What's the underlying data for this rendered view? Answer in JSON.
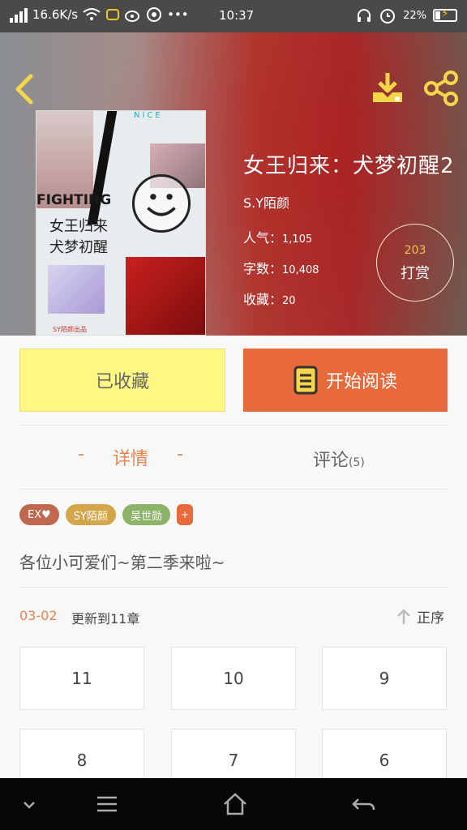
{
  "status_bar": {
    "speed": "16.6K/s",
    "time": "10:37",
    "battery": "22%"
  },
  "cover": {
    "top_label": "NICE",
    "fighting": "FIGHTING",
    "title_line1": "女王归来",
    "title_line2": "犬梦初醒",
    "author_line": "SY陌颜出品"
  },
  "book": {
    "title": "女王归来：犬梦初醒2",
    "author": "S.Y陌颜",
    "popularity_label": "人气：",
    "popularity": "1,105",
    "words_label": "字数：",
    "words": "10,408",
    "favorites_label": "收藏：",
    "favorites": "20",
    "tip_count": "203",
    "tip_label": "打赏"
  },
  "actions": {
    "collected": "已收藏",
    "start_reading": "开始阅读"
  },
  "tabs": {
    "details": "详情",
    "details_dash": "-",
    "comments": "评论",
    "comments_count": "(5)"
  },
  "tags": [
    {
      "label": "EX♥",
      "color": "#c0674f"
    },
    {
      "label": "SY陌颜",
      "color": "#d3a64a"
    },
    {
      "label": "吴世勋",
      "color": "#8cb368"
    },
    {
      "label": "+",
      "color": "#e8693a"
    }
  ],
  "description": "各位小可爱们~第二季来啦~",
  "update": {
    "date": "03-02",
    "text": "更新到11章",
    "sort_label": "正序"
  },
  "chapters": [
    "11",
    "10",
    "9",
    "8",
    "7",
    "6"
  ],
  "colors": {
    "accent": "#e8693a",
    "collected_bg": "#fef784"
  }
}
